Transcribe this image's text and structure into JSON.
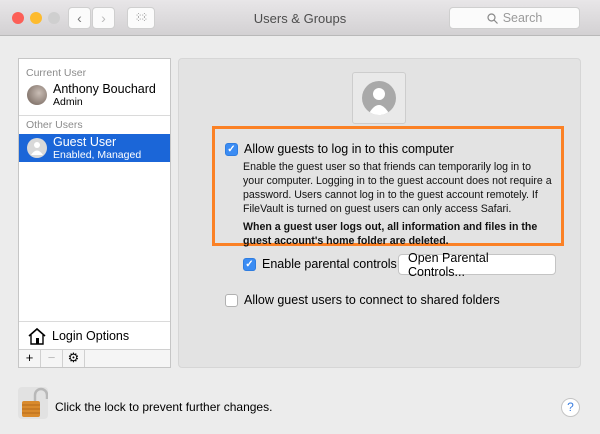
{
  "window": {
    "title": "Users & Groups",
    "search_placeholder": "Search"
  },
  "sidebar": {
    "current_user_header": "Current User",
    "current_user": {
      "name": "Anthony Bouchard",
      "role": "Admin"
    },
    "other_users_header": "Other Users",
    "other_users": [
      {
        "name": "Guest User",
        "status": "Enabled, Managed"
      }
    ],
    "login_options": "Login Options"
  },
  "main": {
    "allow_guests": {
      "label": "Allow guests to log in to this computer",
      "checked": true
    },
    "description": [
      "Enable the guest user so that friends can temporarily log in to",
      "your computer. Logging in to the guest account does not require a",
      "password. Users cannot log in to the guest account remotely. If",
      "FileVault is turned on guest users can only access Safari."
    ],
    "warning": [
      "When a guest user logs out, all information and files in the",
      "guest account's home folder are deleted."
    ],
    "parental": {
      "label": "Enable parental controls",
      "checked": true,
      "button": "Open Parental Controls..."
    },
    "shared": {
      "label": "Allow guest users to connect to shared folders",
      "checked": false
    }
  },
  "footer": {
    "lock_text": "Click the lock to prevent further changes.",
    "help": "?"
  },
  "colors": {
    "highlight": "#fb8125",
    "selection": "#1b66d8"
  }
}
